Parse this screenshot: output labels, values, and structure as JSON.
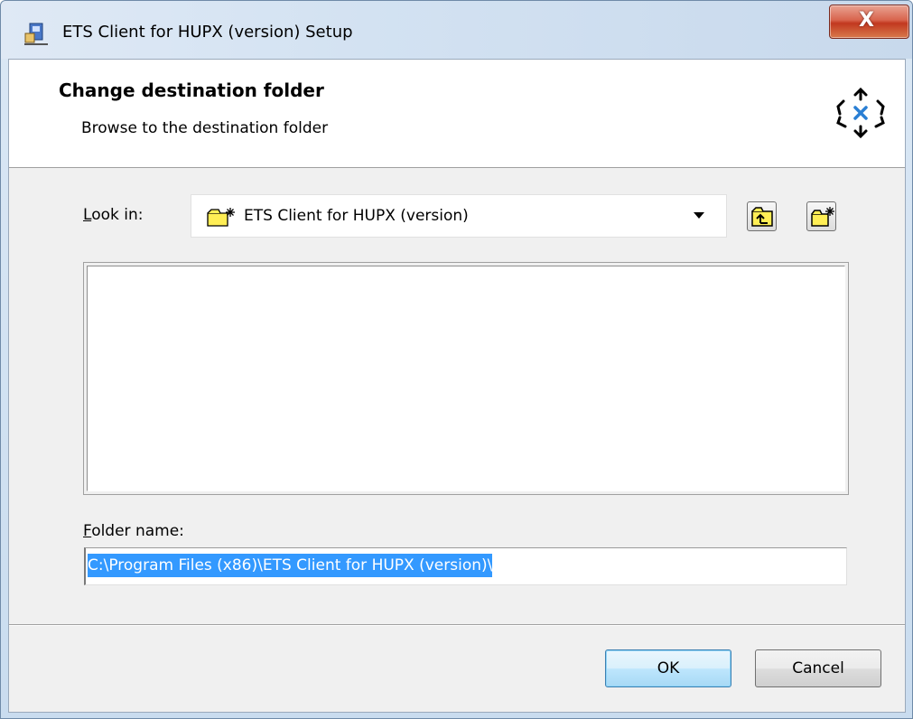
{
  "window": {
    "title": "ETS Client for HUPX (version) Setup",
    "close_glyph": "X"
  },
  "banner": {
    "title": "Change destination folder",
    "subtitle": "Browse to the destination folder",
    "logo_icon": "arrows-cross-logo-icon"
  },
  "look_in": {
    "label_underlined": "L",
    "label_rest": "ook in:",
    "selected": "ETS Client for HUPX (version)",
    "icon": "new-folder-icon"
  },
  "toolbar": {
    "up_icon": "folder-up-icon",
    "new_icon": "new-folder-icon"
  },
  "folder_name": {
    "label_underlined": "F",
    "label_rest": "older name:",
    "value": "C:\\Program Files (x86)\\ETS Client for HUPX (version)\\"
  },
  "buttons": {
    "ok": "OK",
    "cancel": "Cancel"
  },
  "colors": {
    "selection": "#3399ff",
    "close_button": "#c7432a",
    "default_button": "#bee6fd"
  }
}
